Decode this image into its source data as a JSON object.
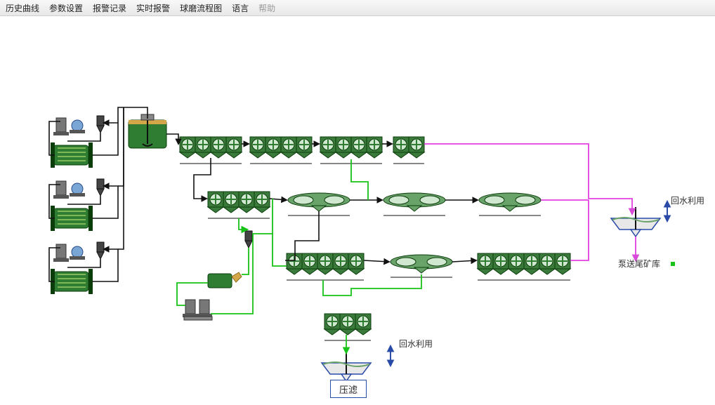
{
  "menu": {
    "history": "历史曲线",
    "params": "参数设置",
    "alarms": "报警记录",
    "rtalarm": "实时报警",
    "flow": "球磨流程图",
    "lang": "语言",
    "help": "帮助"
  },
  "labels": {
    "recycle_r": "回水利用",
    "recycle_b": "回水利用",
    "tailings": "泵送尾矿库",
    "filter": "压滤"
  }
}
